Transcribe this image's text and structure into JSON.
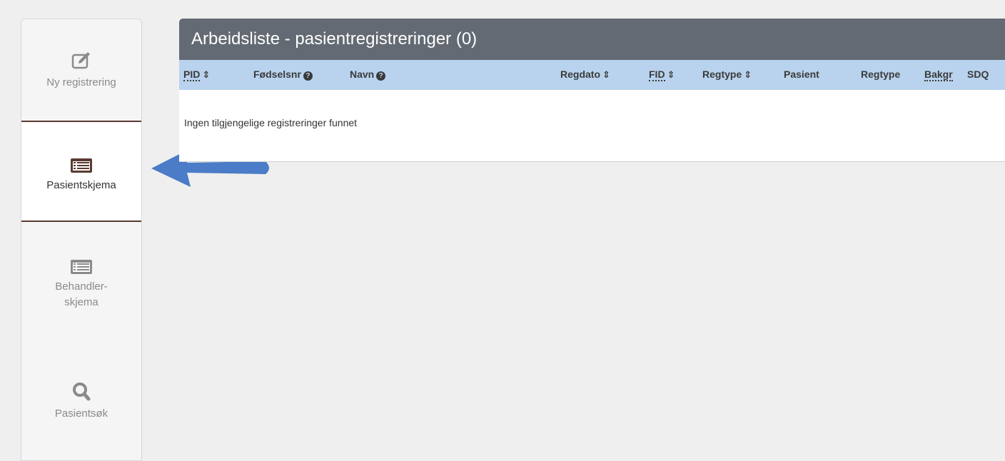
{
  "sidebar": {
    "items": [
      {
        "label": "Ny registrering",
        "icon": "edit-icon"
      },
      {
        "label": "Pasientskjema",
        "icon": "list-icon",
        "active": true
      },
      {
        "label": "Behandler-",
        "label2": "skjema",
        "icon": "list-icon"
      },
      {
        "label": "Pasientsøk",
        "icon": "search-icon"
      }
    ]
  },
  "worklist": {
    "title": "Arbeidsliste - pasientregistreringer (0)",
    "columns": [
      {
        "label": "PID",
        "sortable": true,
        "abbr": true
      },
      {
        "label": "Fødselsnr",
        "help": true
      },
      {
        "label": "Navn",
        "help": true
      },
      {
        "label": "Regdato",
        "sortable": true
      },
      {
        "label": "FID",
        "sortable": true,
        "abbr": true
      },
      {
        "label": "Regtype",
        "sortable": true
      },
      {
        "label": "Pasient"
      },
      {
        "label": "Regtype"
      },
      {
        "label": "Bakgr",
        "abbr": true
      },
      {
        "label": "SDQ"
      }
    ],
    "sort_glyph": "⇕",
    "help_glyph": "?",
    "empty_message": "Ingen tilgjengelige registreringer funnet"
  },
  "colors": {
    "header_bg": "#636a73",
    "column_bar_bg": "#b9d3ee",
    "arrow": "#4a7cc7",
    "divider": "#5a3a32"
  }
}
